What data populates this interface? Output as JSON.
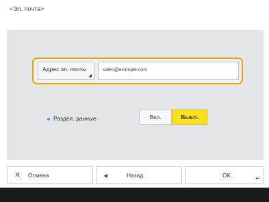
{
  "screen": {
    "title": "<Эл. почта>"
  },
  "address": {
    "label": "Адрес эл. почты",
    "value": "sales@example.com",
    "corner_icon": "corner-arrow-icon"
  },
  "divide": {
    "label": "Раздел. данные",
    "on_label": "Вкл.",
    "off_label": "Выкл.",
    "selected": "off"
  },
  "footer": {
    "cancel_label": "Отмена",
    "cancel_icon": "close-icon",
    "back_label": "Назад",
    "back_icon": "arrow-left-icon",
    "ok_label": "OK",
    "ok_icon": "enter-icon"
  },
  "colors": {
    "accent": "#f0a400",
    "selected_toggle": "#ffe01a",
    "bullet": "#3aa0dc",
    "panel": "#e3e5e9"
  }
}
